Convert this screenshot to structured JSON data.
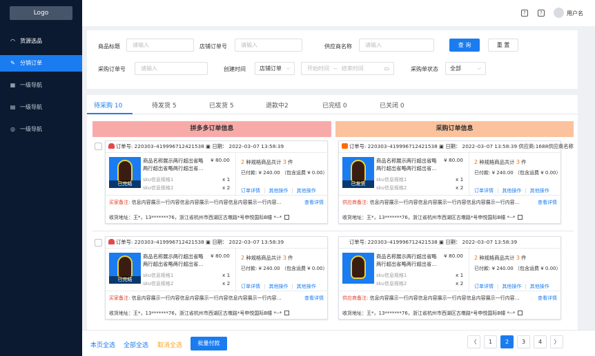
{
  "sidebar": {
    "logo": "Logo",
    "items": [
      {
        "icon": "source-icon",
        "glyph": "◠",
        "label": "货源选品"
      },
      {
        "icon": "edit-icon",
        "glyph": "✎",
        "label": "分销订单"
      },
      {
        "icon": "grid-icon",
        "glyph": "▦",
        "label": "一级导航"
      },
      {
        "icon": "doc-icon",
        "glyph": "▤",
        "label": "一级导航"
      },
      {
        "icon": "check-circle-icon",
        "glyph": "◎",
        "label": "一级导航"
      }
    ],
    "active_index": 1
  },
  "topbar": {
    "help_icon": "?",
    "help_icon2": "?",
    "username": "用户名"
  },
  "filter": {
    "product_title_label": "商品标题",
    "product_title_placeholder": "请输入",
    "store_order_label": "店铺订单号",
    "store_order_placeholder": "请输入",
    "supplier_label": "供应商名称",
    "supplier_placeholder": "请输入",
    "query_button": "查 询",
    "reset_button": "重 置",
    "purchase_order_label": "采购订单号",
    "purchase_order_placeholder": "请输入",
    "created_time_label": "创建时间",
    "created_time_select": "店铺订单",
    "date_start_placeholder": "开始时间",
    "date_sep": "~",
    "date_end_placeholder": "结束时间",
    "purchase_status_label": "采购单状态",
    "purchase_status_select": "全部"
  },
  "tabs": [
    {
      "label": "待采购 10"
    },
    {
      "label": "待发货 5"
    },
    {
      "label": "已发货 5"
    },
    {
      "label": "退款中2"
    },
    {
      "label": "已完结 0"
    },
    {
      "label": "已关闭 0"
    }
  ],
  "columns": {
    "left": "拼多多订单信息",
    "right": "采购订单信息"
  },
  "orders": [
    {
      "left": {
        "marker": "pdd",
        "header": "订单号: 220303–419996712421538 ▣ 日期： 2022–03–07 13:58:39",
        "product_name": "商品名称展示两行超出省略两行超出省略两行超出省…",
        "price": "¥ 80.00",
        "stamp": "已完结",
        "sku1": "sku信息规格1",
        "qty1": "x 1",
        "sku2": "sku信息规格2",
        "qty2": "x 2",
        "summary_pre": "2",
        "summary_mid": " 种规格商品共计 ",
        "summary_count": "3",
        "summary_post": " 件",
        "paid": "已付款: ¥ 240.00 （包含运费 ¥ 0.00）",
        "links": [
          "订单详情",
          "其他操作",
          "其他操作"
        ],
        "remark_label": "买家备注:",
        "remark": " 信息内容展示一行内容信息内容展示一行内容信息内容展示一行内容…",
        "detail": "查看详情",
        "address": "收货地址：王*，13*******76，浙江省杭州市西湖区古墩路*号申悦国际B幢 *--*"
      },
      "right": {
        "marker": "1688",
        "header": "订单号: 220303–419996712421538 ▣ 日期： 2022–03–07 13:58:39  供应商:1688供应商名称",
        "product_name": "商品名称展示两行超出省略两行超出省略两行超出省…",
        "price": "¥ 80.00",
        "stamp": "已发货",
        "sku1": "sku信息规格1",
        "qty1": "x 1",
        "sku2": "sku信息规格2",
        "qty2": "x 2",
        "summary_pre": "2",
        "summary_mid": " 种规格商品共计 ",
        "summary_count": "3",
        "summary_post": " 件",
        "paid": "已付款: ¥ 240.00 （包含运费 ¥ 0.00）",
        "links": [
          "订单详情",
          "其他操作",
          "其他操作"
        ],
        "remark_label": "供应商备注:",
        "remark": " 信息内容展示一行内容信息内容展示一行内容信息内容展示一行内容…",
        "detail": "查看详情",
        "address": "收货地址：王*，13*******76，浙江省杭州市西湖区古墩路*号申悦国际B幢 *--*"
      }
    },
    {
      "left": {
        "marker": "pdd",
        "header": "订单号: 220303–419996712421538 ▣ 日期： 2022–03–07 13:58:39",
        "product_name": "商品名称展示两行超出省略两行超出省略两行超出省…",
        "price": "¥ 80.00",
        "stamp": "已完结",
        "sku1": "sku信息规格1",
        "qty1": "x 1",
        "sku2": "sku信息规格2",
        "qty2": "x 2",
        "summary_pre": "2",
        "summary_mid": " 种规格商品共计 ",
        "summary_count": "3",
        "summary_post": " 件",
        "paid": "已付款: ¥ 240.00 （包含运费 ¥ 0.00）",
        "links": [
          "订单详情",
          "其他操作",
          "其他操作"
        ],
        "remark_label": "买家备注:",
        "remark": " 信息内容展示一行内容信息内容展示一行内容信息内容展示一行内容…",
        "detail": "查看详情",
        "address": "收货地址：王*，13*******76，浙江省杭州市西湖区古墩路*号申悦国际B幢 *--*"
      },
      "right": {
        "marker": "none",
        "header": "订单号: 220303–419996712421538 ▣ 日期： 2022–03–07 13:58:39",
        "product_name": "商品名称展示两行超出省略两行超出省略两行超出省…",
        "price": "¥ 80.00",
        "stamp": "",
        "sku1": "sku信息规格1",
        "qty1": "x 1",
        "sku2": "sku信息规格2",
        "qty2": "x 2",
        "summary_pre": "2",
        "summary_mid": " 种规格商品共计 ",
        "summary_count": "3",
        "summary_post": " 件",
        "paid": "已付款: ¥ 240.00 （包含运费 ¥ 0.00）",
        "links": [
          "订单详情",
          "其他操作",
          "其他操作"
        ],
        "remark_label": "供应商备注:",
        "remark": " 信息内容展示一行内容信息内容展示一行内容信息内容展示一行内容…",
        "detail": "查看详情",
        "address": "收货地址：王*，13*******76，浙江省杭州市西湖区古墩路*号申悦国际B幢 *--*"
      }
    }
  ],
  "footer": {
    "select_page": "本页全选",
    "select_all": "全部全选",
    "cancel_select": "取消全选",
    "batch_pay": "批量付款",
    "prev": "〈",
    "pages": [
      "1",
      "2",
      "3",
      "4"
    ],
    "current_page": "2",
    "next": "〉"
  },
  "colors": {
    "primary": "#1a7cf0",
    "sidebar_bg": "#0b1a30",
    "left_header": "#f8aaa9",
    "right_header": "#fbc29d",
    "remark_label": "#e0402c",
    "highlight": "#f56c00"
  }
}
